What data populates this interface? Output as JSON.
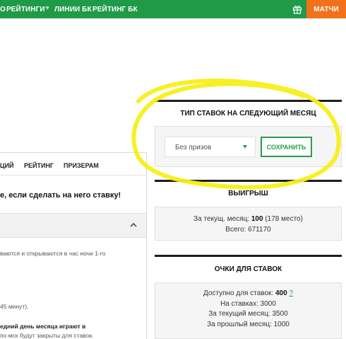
{
  "topnav": {
    "items": [
      "О",
      "РЕЙТИНГИ",
      "ЛИНИИ БК",
      "РЕЙТИНГ БК"
    ],
    "matches_label": "МАТЧИ"
  },
  "left": {
    "tabs": [
      "ЦИЙ",
      "РЕЙТИНГ",
      "ПРИЗЕРАМ"
    ],
    "headline": "е, если сделать на него ставку!",
    "rules": [
      "ваются и открываются в час ночи 1-го",
      "45 минут).",
      "едний день месяца играют в",
      "по мск будут закрыты для ставок."
    ]
  },
  "bet_type": {
    "title": "ТИП СТАВОК НА СЛЕДУЮЩИЙ МЕСЯЦ",
    "selected": "Без призов",
    "save_label": "СОХРАНИТЬ"
  },
  "winnings": {
    "title": "ВЫИГРЫШ",
    "month_label": "За текущ. месяц:",
    "month_value": "100",
    "month_place": "(178 место)",
    "total_label": "Всего:",
    "total_value": "671170"
  },
  "points": {
    "title": "ОЧКИ ДЛЯ СТАВОК",
    "available_label": "Доступно для ставок:",
    "available_value": "400",
    "help": "?",
    "on_bets": "На ставках: 3000",
    "current_month": "За текущий месяц: 3500",
    "last_month": "За прошлый месяц: 1000"
  },
  "colors": {
    "nav_green": "#1f9a47",
    "accent_orange": "#f2711c",
    "accent_green": "#2a9d4e",
    "highlight": "#f7ef1a"
  }
}
